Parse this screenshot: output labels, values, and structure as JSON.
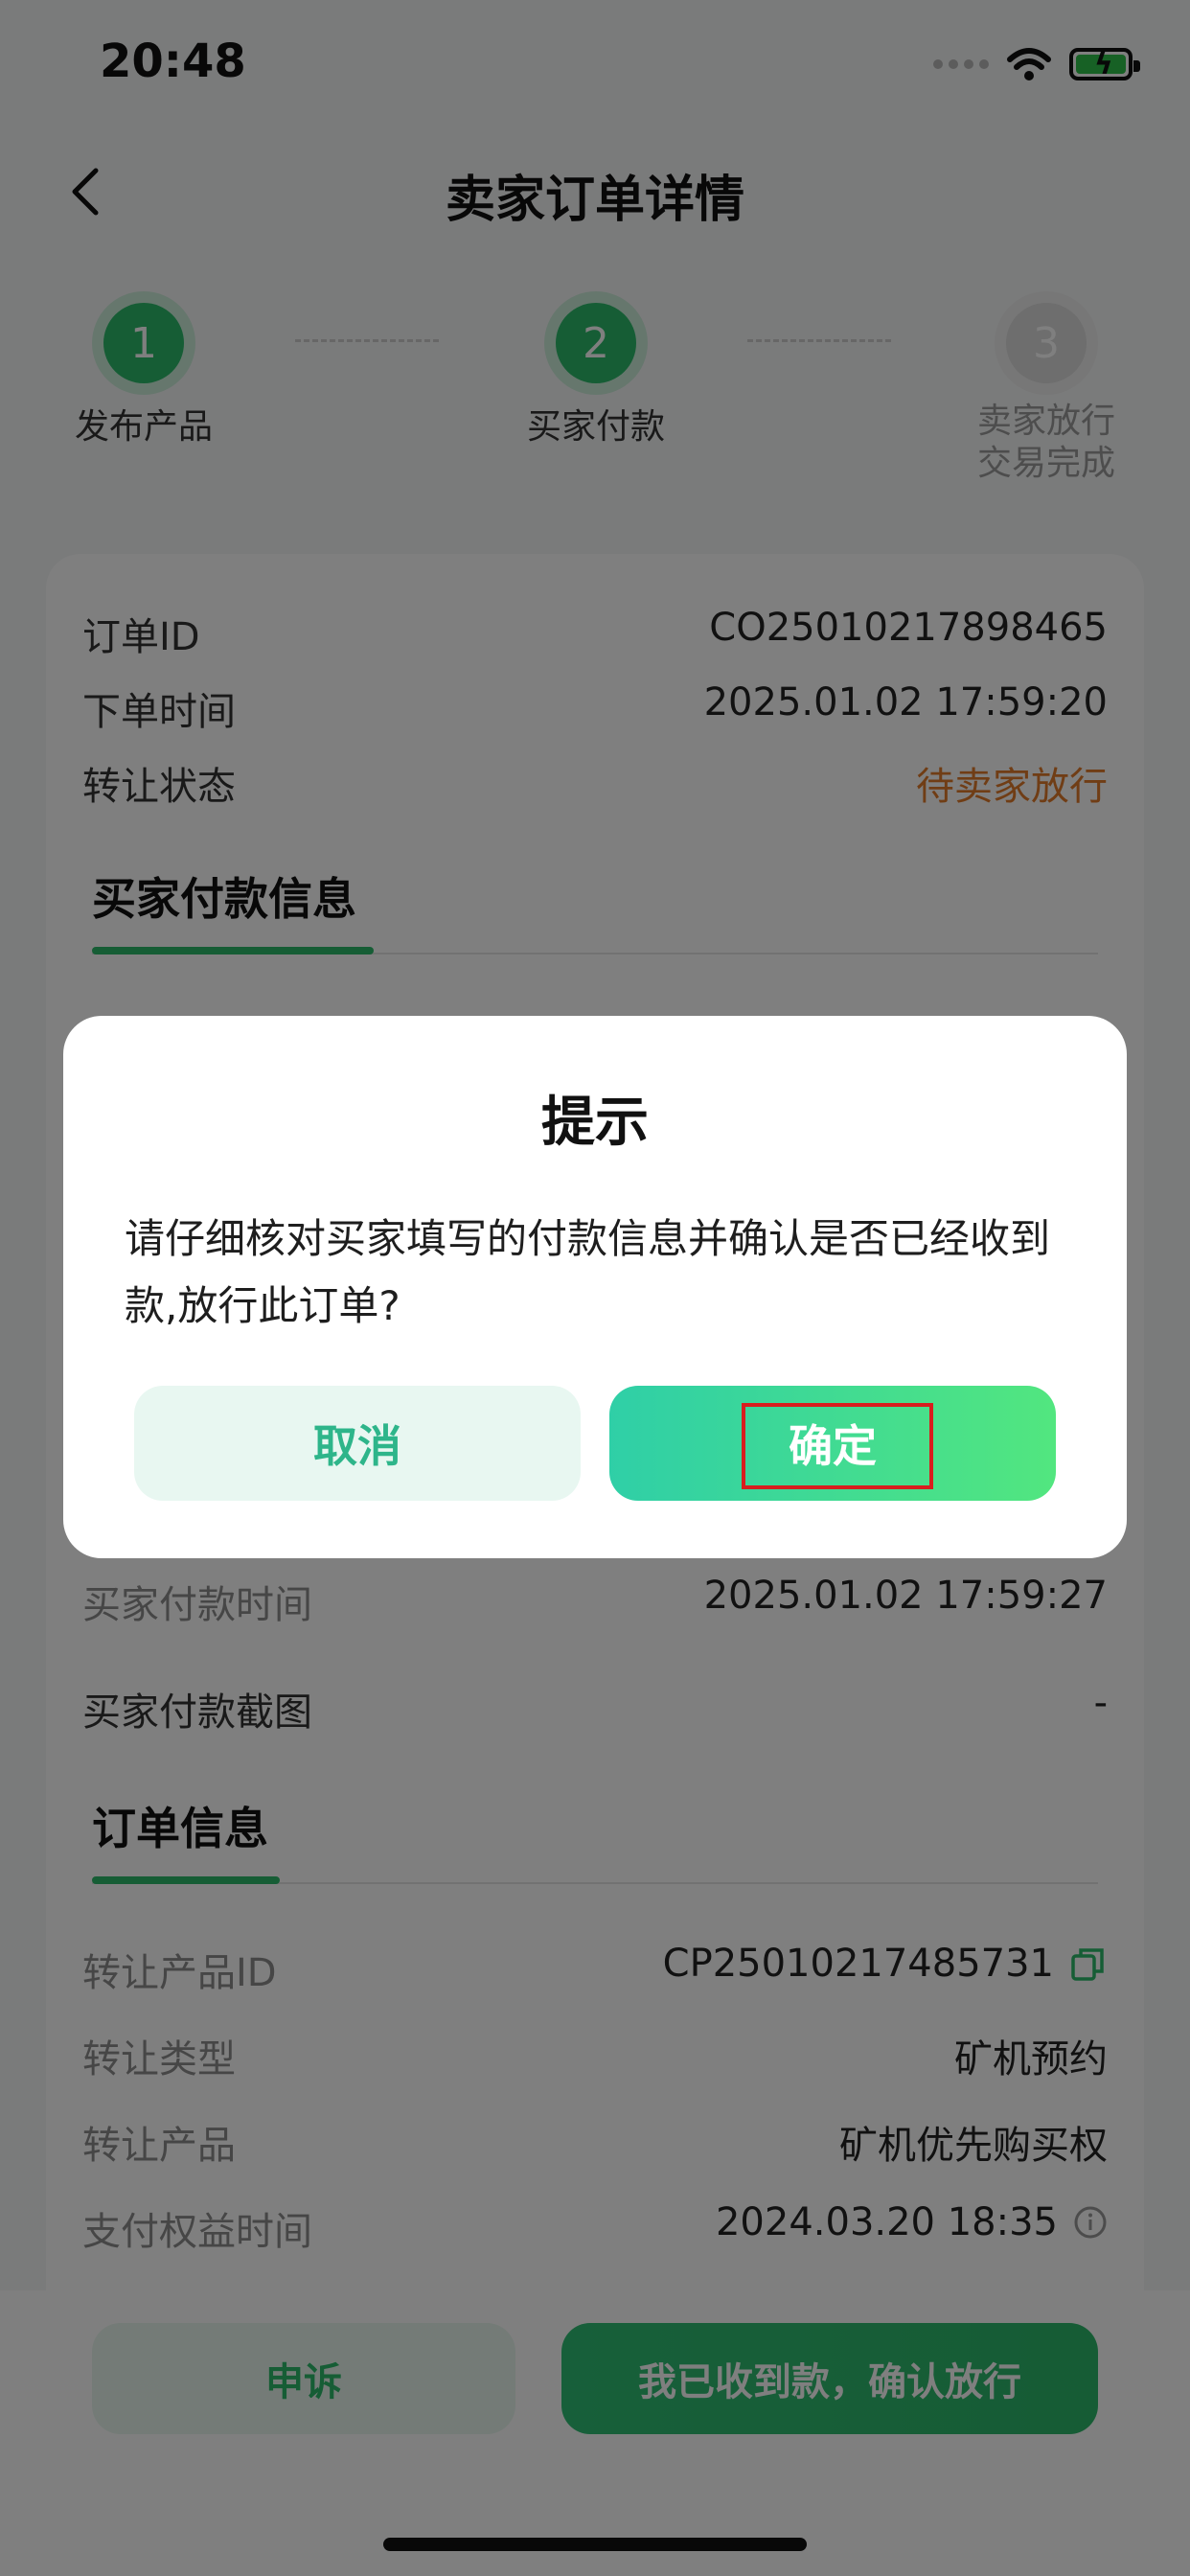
{
  "status_bar": {
    "time": "20:48"
  },
  "nav": {
    "title": "卖家订单详情"
  },
  "steps": [
    {
      "number": "1",
      "label": "发布产品",
      "state": "done"
    },
    {
      "number": "2",
      "label": "买家付款",
      "state": "done"
    },
    {
      "number": "3",
      "label_line1": "卖家放行",
      "label_line2": "交易完成",
      "state": "todo"
    }
  ],
  "order_summary": {
    "order_id_label": "订单ID",
    "order_id_value": "CO25010217898465",
    "order_time_label": "下单时间",
    "order_time_value": "2025.01.02 17:59:20",
    "status_label": "转让状态",
    "status_value": "待卖家放行"
  },
  "buyer_payment": {
    "section_title": "买家付款信息",
    "pay_time_label": "买家付款时间",
    "pay_time_value": "2025.01.02 17:59:27",
    "screenshot_label": "买家付款截图",
    "screenshot_value": "-"
  },
  "order_info": {
    "section_title": "订单信息",
    "product_id_label": "转让产品ID",
    "product_id_value": "CP25010217485731",
    "type_label": "转让类型",
    "type_value": "矿机预约",
    "product_label": "转让产品",
    "product_value": "矿机优先购买权",
    "rights_time_label": "支付权益时间",
    "rights_time_value": "2024.03.20 18:35"
  },
  "bottom_actions": {
    "appeal_label": "申诉",
    "confirm_release_label": "我已收到款，确认放行"
  },
  "dialog": {
    "title": "提示",
    "message": "请仔细核对买家填写的付款信息并确认是否已经收到款,放行此订单?",
    "cancel_label": "取消",
    "ok_label": "确定"
  },
  "colors": {
    "brand_green": "#2cba6b",
    "status_orange": "#e07b2a",
    "highlight_red": "#d81e1e"
  }
}
